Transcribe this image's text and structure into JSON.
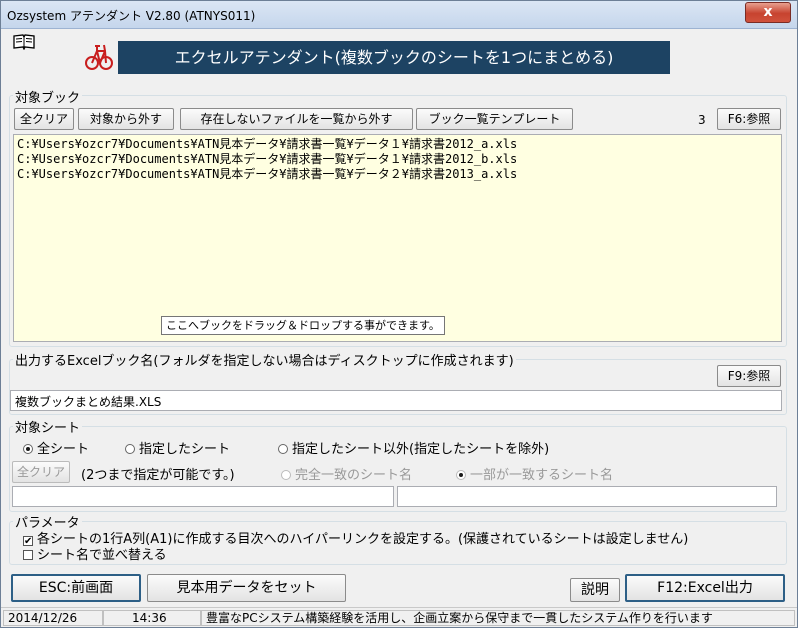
{
  "window": {
    "title": "Ozsystem アテンダント V2.80 (ATNYS011)",
    "close_glyph": "x",
    "accent": "#1d4363"
  },
  "header": {
    "banner": "エクセルアテンダント(複数ブックのシートを1つにまとめる)",
    "book_icon": "book-icon",
    "bike_icon": "bicycle-icon"
  },
  "target_books": {
    "label": "対象ブック",
    "buttons": {
      "clear_all": "全クリア",
      "remove": "対象から外す",
      "remove_missing": "存在しないファイルを一覧から外す",
      "template": "ブック一覧テンプレート",
      "browse": "F6:参照"
    },
    "count": "3",
    "files": [
      "C:¥Users¥ozcr7¥Documents¥ATN見本データ¥請求書一覧¥データ１¥請求書2012_a.xls",
      "C:¥Users¥ozcr7¥Documents¥ATN見本データ¥請求書一覧¥データ１¥請求書2012_b.xls",
      "C:¥Users¥ozcr7¥Documents¥ATN見本データ¥請求書一覧¥データ２¥請求書2013_a.xls"
    ],
    "drop_hint": "ここへブックをドラッグ＆ドロップする事ができます。"
  },
  "output": {
    "label": "出力するExcelブック名(フォルダを指定しない場合はディスクトップに作成されます)",
    "browse": "F9:参照",
    "value": "複数ブックまとめ結果.XLS"
  },
  "target_sheets": {
    "label": "対象シート",
    "radios": {
      "all": "全シート",
      "specified": "指定したシート",
      "except": "指定したシート以外(指定したシートを除外)"
    },
    "clear": "全クリア",
    "note": "(2つまで指定が可能です。)",
    "match_exact": "完全一致のシート名",
    "match_partial": "一部が一致するシート名",
    "sheet1": "",
    "sheet2": ""
  },
  "params": {
    "label": "パラメータ",
    "hyperlink": {
      "text": "各シートの1行A列(A1)に作成する目次へのハイパーリンクを設定する。(保護されているシートは設定しません)",
      "checked": true,
      "mark": "✔"
    },
    "sort": {
      "text": "シート名で並べ替える",
      "checked": false
    }
  },
  "footer": {
    "esc": "ESC:前画面",
    "sample": "見本用データをセット",
    "help": "説明",
    "run": "F12:Excel出力"
  },
  "statusbar": {
    "date": "2014/12/26",
    "time": "14:36",
    "message": "豊富なPCシステム構築経験を活用し、企画立案から保守まで一貫したシステム作りを行います"
  }
}
